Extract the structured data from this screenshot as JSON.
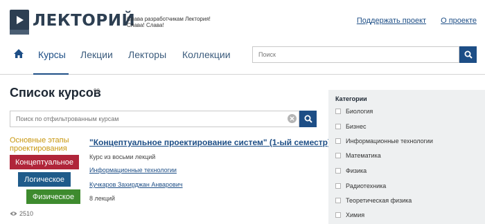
{
  "header": {
    "logo_text": "ЛЕКТОРИЙ",
    "tagline": "Слава разработчикам Лектория! Слава! Слава!",
    "links": [
      "Поддержать проект",
      "О проекте"
    ]
  },
  "nav": {
    "items": [
      "Курсы",
      "Лекции",
      "Лекторы",
      "Коллекции"
    ],
    "active": "Курсы",
    "search_placeholder": "Поиск"
  },
  "main": {
    "title": "Список курсов",
    "count": "90",
    "filter_placeholder": "Поиск по отфильтрованным курсам"
  },
  "course": {
    "thumb": {
      "caption_line1": "Основные этапы",
      "caption_line2": "проектирования",
      "stages": [
        "Концептуальное",
        "Логическое",
        "Физическое"
      ],
      "colors": [
        "#b0253a",
        "#1f5b8a",
        "#3e8b2e"
      ]
    },
    "title": "\"Концептуальное проектирование систем\" (1-ый семестр)",
    "description": "Курс из восьми лекций",
    "category": "Информационные технологии",
    "lecturer": "Кучкаров Захирджан Анварович",
    "lectures": "8 лекций",
    "views": "2510"
  },
  "sidebar": {
    "title": "Категории",
    "categories": [
      "Биология",
      "Бизнес",
      "Информационные технологии",
      "Математика",
      "Физика",
      "Радиотехника",
      "Теоретическая физика",
      "Химия"
    ]
  },
  "colors": {
    "accent": "#1d4e86",
    "logo": "#2d3f52"
  }
}
